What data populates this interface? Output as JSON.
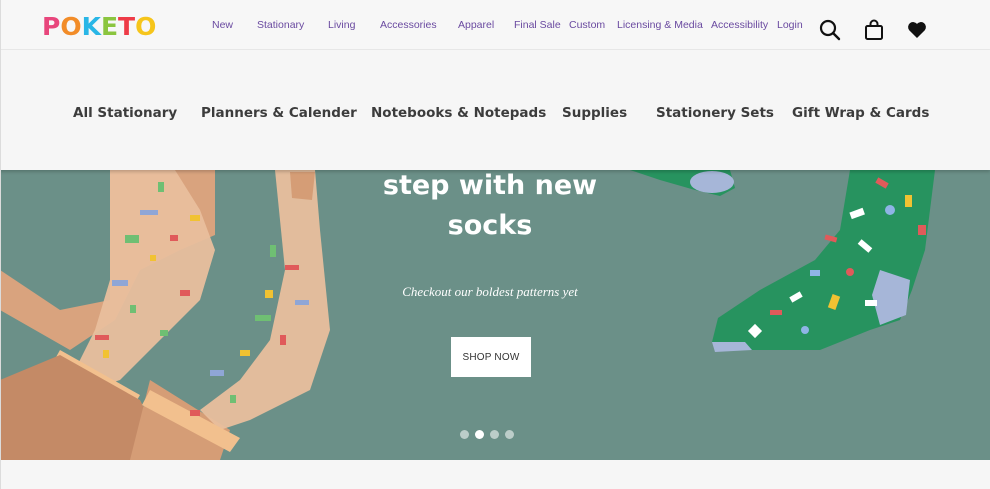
{
  "header": {
    "logo_letters": [
      {
        "char": "P",
        "color": "#e8467c"
      },
      {
        "char": "O",
        "color": "#f28c28"
      },
      {
        "char": "K",
        "color": "#29b6e6"
      },
      {
        "char": "E",
        "color": "#8bc53f"
      },
      {
        "char": "T",
        "color": "#ee3b47"
      },
      {
        "char": "O",
        "color": "#f6c51b"
      }
    ],
    "nav": [
      "New",
      "Stationary",
      "Living",
      "Accessories",
      "Apparel",
      "Final Sale",
      "Custom",
      "Licensing & Media",
      "Accessibility",
      "Login"
    ],
    "icons": [
      "search-icon",
      "cart-icon",
      "heart-icon"
    ]
  },
  "categories": [
    "All Stationary",
    "Planners & Calender",
    "Notebooks & Notepads",
    "Supplies",
    "Stationery Sets",
    "Gift Wrap & Cards"
  ],
  "hero": {
    "title_line1": "step with new",
    "title_line2": "socks",
    "subtitle": "Checkout our boldest patterns yet",
    "button": "SHOP NOW",
    "slides": 4,
    "active_slide": 2,
    "bg_color": "#6b9088"
  }
}
